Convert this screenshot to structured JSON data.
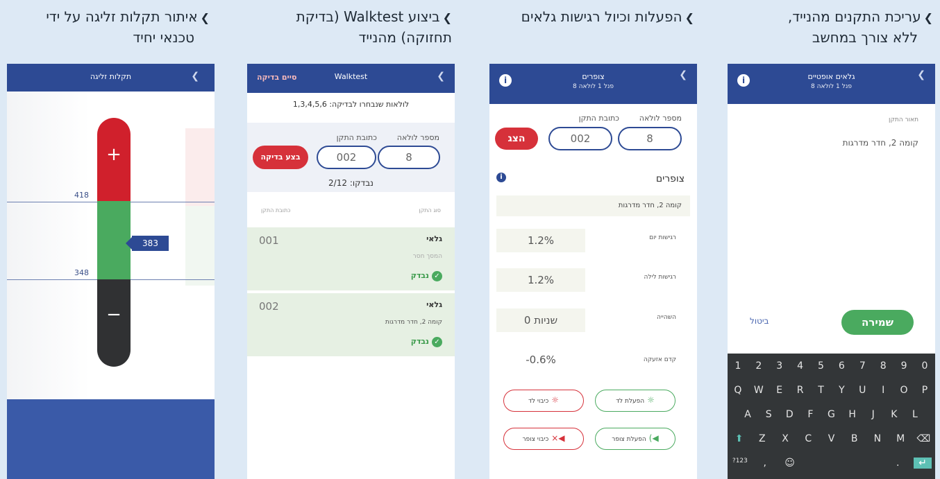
{
  "captions": {
    "c1_line1": "עריכת התקנים מהנייד,",
    "c1_line2": "ללא צורך במחשב",
    "c2": "הפעלות וכיול רגישות גלאים",
    "c3_line1": "ביצוע Walktest (בדיקת",
    "c3_line2": "תחזוקה) מהנייד",
    "c4_line1": "איתור תקלות זליגה על ידי",
    "c4_line2": "טכנאי יחיד"
  },
  "phone1": {
    "title": "גלאים אופטיים",
    "subtitle": "פנל 1 לולאה 8",
    "field_label": "תאור התקן",
    "field_value": "קומה 2, חדר מדרגות",
    "save_label": "שמירה",
    "cancel_label": "ביטול",
    "keyboard": {
      "row1": [
        "1",
        "2",
        "3",
        "4",
        "5",
        "6",
        "7",
        "8",
        "9",
        "0"
      ],
      "row2": [
        "Q",
        "W",
        "E",
        "R",
        "T",
        "Y",
        "U",
        "I",
        "O",
        "P"
      ],
      "row3": [
        "A",
        "S",
        "D",
        "F",
        "G",
        "H",
        "J",
        "K",
        "L"
      ],
      "row4": [
        "⬆",
        "Z",
        "X",
        "C",
        "V",
        "B",
        "N",
        "M",
        "⌫"
      ],
      "row5": [
        "?123",
        ",",
        "☺",
        " ",
        ".",
        "↵"
      ]
    }
  },
  "phone2": {
    "title": "צופרים",
    "subtitle": "פנל 1 לולאה 8",
    "loop_label": "מספר לולאה",
    "addr_label": "כתובת התקן",
    "loop_value": "8",
    "addr_value": "002",
    "show_label": "הצג",
    "section_title": "צופרים",
    "location": "קומה 2, חדר מדרגות",
    "rows": [
      {
        "label": "רגישות יום",
        "value": "1.2%"
      },
      {
        "label": "רגישות לילה",
        "value": "1.2%"
      },
      {
        "label": "השהייה",
        "value": "0 שניות"
      },
      {
        "label": "קדם אזעקה",
        "value": "-0.6%"
      }
    ],
    "controls": {
      "led_on": "הפעלת לד",
      "led_off": "כיבוי לד",
      "horn_on": "הפעלת צופר",
      "horn_off": "כיבוי צופר"
    }
  },
  "phone3": {
    "title": "Walktest",
    "finish_label": "סיים בדיקה",
    "selected_loops": "לולאות שנבחרו לבדיקה: 1,3,4,5,6",
    "loop_label": "מספר לולאה",
    "addr_label": "כתובת התקן",
    "loop_value": "8",
    "addr_value": "002",
    "run_label": "בצע בדיקה",
    "checked_count": "נבדקו: 2/12",
    "col_type": "סוג התקן",
    "col_addr": "כתובת התקן",
    "items": [
      {
        "num": "001",
        "type": "גלאי",
        "addr": "המסך חסר",
        "status": "נבדק"
      },
      {
        "num": "002",
        "type": "גלאי",
        "addr": "קומה 2, חדר מדרגות",
        "status": "נבדק"
      }
    ]
  },
  "phone4": {
    "title": "תקלות זליגה",
    "upper_value": "418",
    "lower_value": "348",
    "current_value": "383",
    "plus": "+",
    "minus": "−"
  },
  "colors": {
    "brand_blue": "#2d4a94",
    "red": "#d6313a",
    "green": "#4aaa5f",
    "background": "#dde9f5"
  }
}
